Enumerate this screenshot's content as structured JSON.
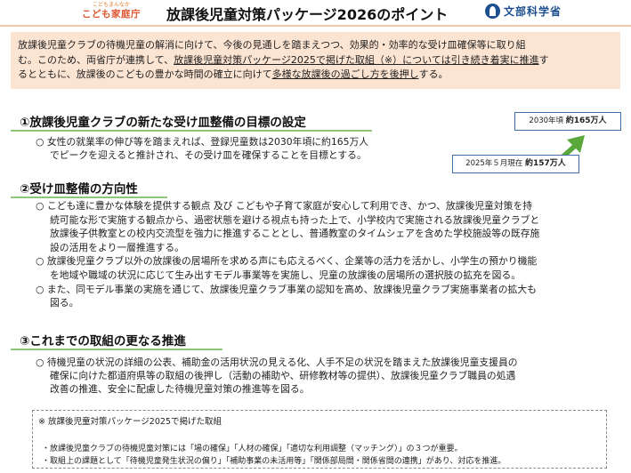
{
  "header": {
    "logo_sub": "こどもまんなか",
    "logo_main": "こども家庭庁",
    "title": "放課後児童対策パッケージ2026のポイント",
    "ministry": "文部科学省",
    "ministry_icon": "ministry-emblem-icon"
  },
  "intro": {
    "line1": "放課後児童クラブの待機児童の解消に向けて、今後の見通しを踏まえつつ、効果的・効率的な受け皿確保等に取り組",
    "line2a": "む。このため、両省庁が連携して、",
    "line2b": "放課後児童対策パッケージ2025で掲げた取組（※）については引き続き着実に推進",
    "line2c": "す",
    "line3a": "るとともに、放課後のこどもの豊かな時間の確立に向けて",
    "line3b": "多様な放課後の過ごし方を後押し",
    "line3c": "する。"
  },
  "section1": {
    "heading": "①放課後児童クラブの新たな受け皿整備の目標の設定",
    "line1": "○ 女性の就業率の伸び等を踏まえれば、登録児童数は2030年頃に約165万人",
    "line2": "でピークを迎えると推計され、その受け皿を確保することを目標とする。",
    "stat_2030_label": "2030年頃",
    "stat_2030_value": "約165万人",
    "stat_2025_label": "2025年５月現在",
    "stat_2025_value": "約157万人",
    "arrow_icon": "up-right-arrow-icon"
  },
  "section2": {
    "heading": "②受け皿整備の方向性",
    "lines": [
      "○ こども達に豊かな体験を提供する観点 及び こどもや子育て家庭が安心して利用でき、かつ、放課後児童対策を持",
      "続可能な形で実施する観点から、過密状態を避ける視点も持った上で、小学校内で実施される放課後児童クラブと",
      "放課後子供教室との校内交流型を強力に推進することとし、普通教室のタイムシェアを含めた学校施設等の既存施",
      "設の活用をより一層推進する。",
      "○ 放課後児童クラブ以外の放課後の居場所を求める声にも応えるべく、企業等の活力を活かし、小学生の預かり機能",
      "を地域や職域の状況に応じて生み出すモデル事業等を実施し、児童の放課後の居場所の選択肢の拡充を図る。",
      "○ また、同モデル事業の実施を通じて、放課後児童クラブ事業の認知を高め、放課後児童クラブ実施事業者の拡大も",
      "図る。"
    ]
  },
  "section3": {
    "heading": "③これまでの取組の更なる推進",
    "lines": [
      "○ 待機児童の状況の詳細の公表、補助金の活用状況の見える化、人手不足の状況を踏まえた放課後児童支援員の",
      "確保に向けた都道府県等の取組の後押し（活動の補助や、研修教材等の提供）、放課後児童クラブ職員の処遇",
      "改善の推進、安全に配慮した待機児童対策の推進等を図る。"
    ]
  },
  "note": {
    "title": "※ 放課後児童対策パッケージ2025で掲げた取組",
    "item1": "・放課後児童クラブの待機児童対策には「場の確保」「人材の確保」「適切な利用調整（マッチング）」の３つが重要。",
    "item2": "・取組上の課題として「待機児童発生状況の偏り」「補助事業の未活用等」「関係部局間・関係省間の連携」があり、対応を推進。"
  }
}
